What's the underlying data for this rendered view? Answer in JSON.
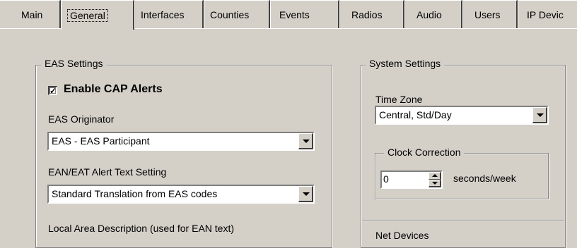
{
  "tabs": [
    {
      "label": "Main"
    },
    {
      "label": "General"
    },
    {
      "label": "Interfaces"
    },
    {
      "label": "Counties"
    },
    {
      "label": "Events"
    },
    {
      "label": "Radios"
    },
    {
      "label": "Audio"
    },
    {
      "label": "Users"
    },
    {
      "label": "IP Devic"
    }
  ],
  "active_tab": "General",
  "eas_settings": {
    "title": "EAS Settings",
    "enable_cap": {
      "label": "Enable CAP Alerts",
      "checked": true,
      "mark": "✓"
    },
    "originator_label": "EAS Originator",
    "originator_value": "EAS - EAS Participant",
    "alert_text_label": "EAN/EAT Alert Text Setting",
    "alert_text_value": "Standard Translation from EAS codes",
    "local_area_label": "Local Area Description (used for EAN text)"
  },
  "system_settings": {
    "title": "System Settings",
    "time_zone_label": "Time Zone",
    "time_zone_value": "Central, Std/Day",
    "clock_correction": {
      "title": "Clock Correction",
      "value": "0",
      "unit": "seconds/week"
    },
    "next_group_title": "Net Devices"
  }
}
